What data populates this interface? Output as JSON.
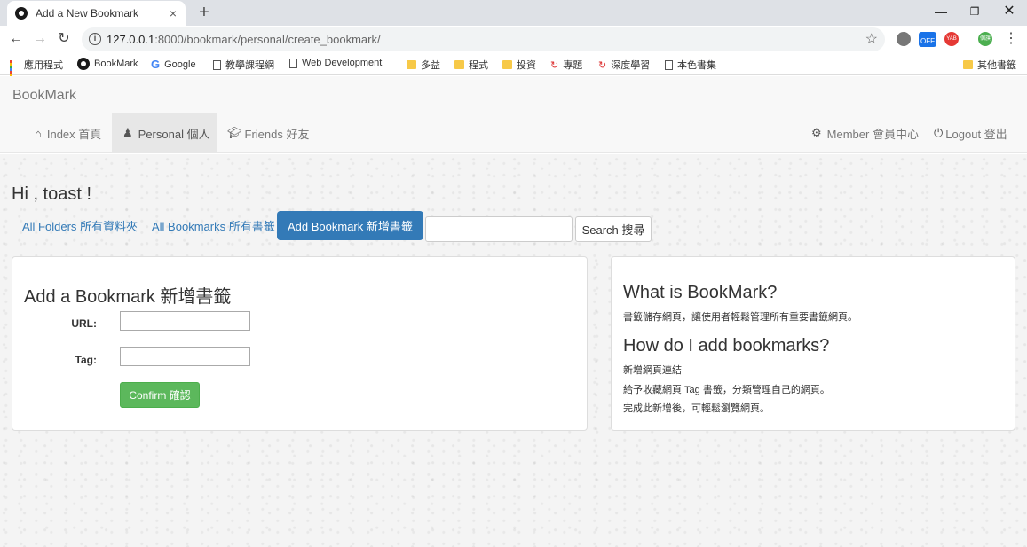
{
  "browser": {
    "tab_title": "Add a New Bookmark",
    "tab_close": "×",
    "new_tab": "+",
    "url_host": "127.0.0.1",
    "url_rest": ":8000/bookmark/personal/create_bookmark/",
    "ext_badge": "OFF",
    "ext_yab": "YAB",
    "profile_label": "個旗"
  },
  "bookmarks_bar": {
    "apps": "應用程式",
    "items": [
      "BookMark",
      "Google",
      "教學課程網",
      "Web Development",
      "多益",
      "程式",
      "投資",
      "專題",
      "深度學習",
      "本色書集"
    ],
    "other": "其他書籤"
  },
  "navbar": {
    "brand": "BookMark",
    "index": "Index 首頁",
    "personal": "Personal 個人",
    "friends": "Friends 好友",
    "member": "Member 會員中心",
    "logout": "Logout 登出"
  },
  "page": {
    "greeting": "Hi , toast !",
    "pills": {
      "folders": "All Folders 所有資料夾",
      "bookmarks": "All Bookmarks 所有書籤",
      "add": "Add Bookmark 新增書籤"
    },
    "search_button": "Search 搜尋",
    "search_value": ""
  },
  "form": {
    "title": "Add a Bookmark 新增書籤",
    "url_label": "URL:",
    "url_value": "",
    "tag_label": "Tag:",
    "tag_value": "",
    "confirm": "Confirm 確認"
  },
  "info": {
    "h1": "What is BookMark?",
    "p1": "書籤儲存網頁，讓使用者輕鬆管理所有重要書籤網頁。",
    "h2": "How do I add bookmarks?",
    "p2": "新增網頁連結",
    "p3": "給予收藏網頁 Tag 書籤，分類管理自己的網頁。",
    "p4": "完成此新增後，可輕鬆瀏覽網頁。"
  },
  "colors": {
    "primary": "#337ab7",
    "success": "#5cb85c"
  }
}
